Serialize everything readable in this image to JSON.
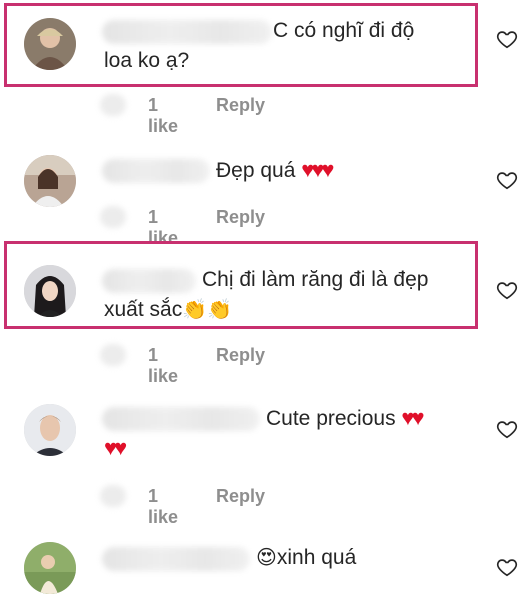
{
  "comments": [
    {
      "text_line1": "C có nghĩ đi độ",
      "text_line2": "loa ko ạ?",
      "likes": "1 like",
      "reply": "Reply",
      "highlighted": true
    },
    {
      "text_line1": "Đẹp quá",
      "hearts": "♥♥♥",
      "likes": "1 like",
      "reply": "Reply",
      "highlighted": false
    },
    {
      "text_line1": "Chị đi làm răng đi là đẹp",
      "text_line2": "xuất sắc",
      "emoji": "👏👏",
      "likes": "1 like",
      "reply": "Reply",
      "highlighted": true
    },
    {
      "text_line1": "Cute precious",
      "hearts1": "♥♥",
      "hearts2": "♥♥",
      "likes": "1 like",
      "reply": "Reply",
      "highlighted": false
    },
    {
      "emoji": "😍",
      "text_line1": "xinh quá",
      "highlighted": false
    }
  ],
  "colors": {
    "highlight": "#c8306f",
    "heart_red": "#e0102a",
    "meta_gray": "#8e8e8e",
    "text": "#262626"
  },
  "icons": {
    "like": "heart-outline-icon"
  }
}
